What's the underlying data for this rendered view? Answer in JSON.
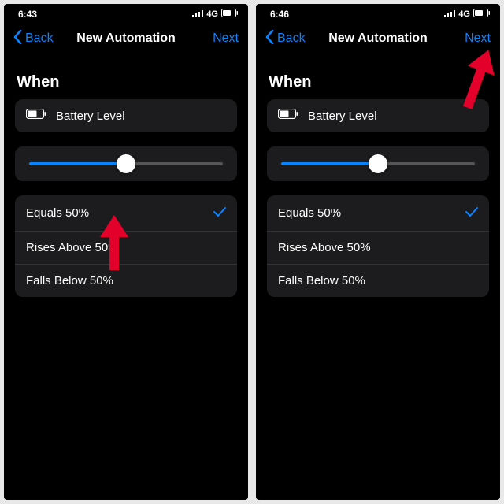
{
  "left": {
    "status": {
      "time": "6:43",
      "network": "4G"
    },
    "nav": {
      "back": "Back",
      "title": "New Automation",
      "next": "Next"
    },
    "section": "When",
    "battery": {
      "label": "Battery Level"
    },
    "slider": {
      "percent": 50
    },
    "options": [
      {
        "label": "Equals 50%",
        "selected": true
      },
      {
        "label": "Rises Above 50%",
        "selected": false
      },
      {
        "label": "Falls Below 50%",
        "selected": false
      }
    ],
    "arrow_target": "slider-thumb"
  },
  "right": {
    "status": {
      "time": "6:46",
      "network": "4G"
    },
    "nav": {
      "back": "Back",
      "title": "New Automation",
      "next": "Next"
    },
    "section": "When",
    "battery": {
      "label": "Battery Level"
    },
    "slider": {
      "percent": 50
    },
    "options": [
      {
        "label": "Equals 50%",
        "selected": true
      },
      {
        "label": "Rises Above 50%",
        "selected": false
      },
      {
        "label": "Falls Below 50%",
        "selected": false
      }
    ],
    "arrow_target": "next-button"
  },
  "colors": {
    "accent": "#0a84ff",
    "arrow": "#e3002b"
  }
}
